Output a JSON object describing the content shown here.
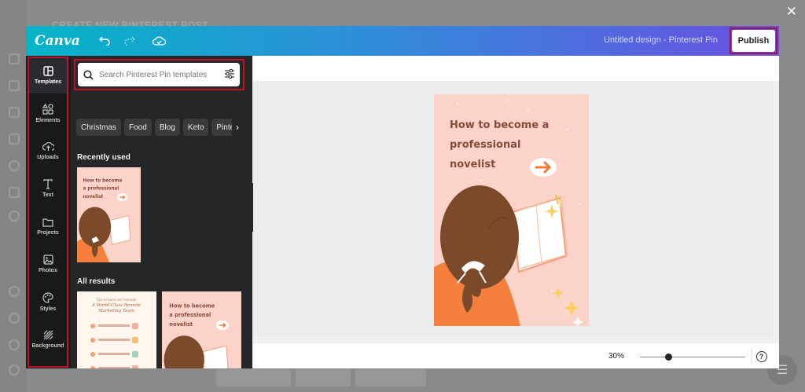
{
  "background": {
    "page_title": "CREATE NEW PINTEREST POST"
  },
  "app": {
    "logo": "Canva",
    "document_title": "Untitled design - Pinterest Pin",
    "publish_label": "Publish",
    "close_icon": "close-icon"
  },
  "nav": {
    "items": [
      {
        "label": "Templates",
        "icon": "templates-icon"
      },
      {
        "label": "Elements",
        "icon": "elements-icon"
      },
      {
        "label": "Uploads",
        "icon": "uploads-icon"
      },
      {
        "label": "Text",
        "icon": "text-icon"
      },
      {
        "label": "Projects",
        "icon": "folder-icon"
      },
      {
        "label": "Photos",
        "icon": "image-icon"
      },
      {
        "label": "Styles",
        "icon": "palette-icon"
      },
      {
        "label": "Background",
        "icon": "background-icon"
      }
    ],
    "active": "Templates"
  },
  "panel": {
    "search_placeholder": "Search Pinterest Pin templates",
    "chips": [
      "Christmas",
      "Food",
      "Blog",
      "Keto",
      "Pinterest"
    ],
    "recently_used_heading": "Recently used",
    "all_results_heading": "All results",
    "template_title": "How to become a professional novelist",
    "template2_title": "A World-Class Remote Marketing Team"
  },
  "canvas": {
    "design_title": "How to become a professional novelist",
    "zoom": "30%",
    "help": "?"
  },
  "colors": {
    "topbar_start": "#04b5c7",
    "topbar_end": "#6a4fe3",
    "design_bg": "#fbd3c9",
    "design_text": "#8a4a3a",
    "highlight": "#c0102a"
  }
}
